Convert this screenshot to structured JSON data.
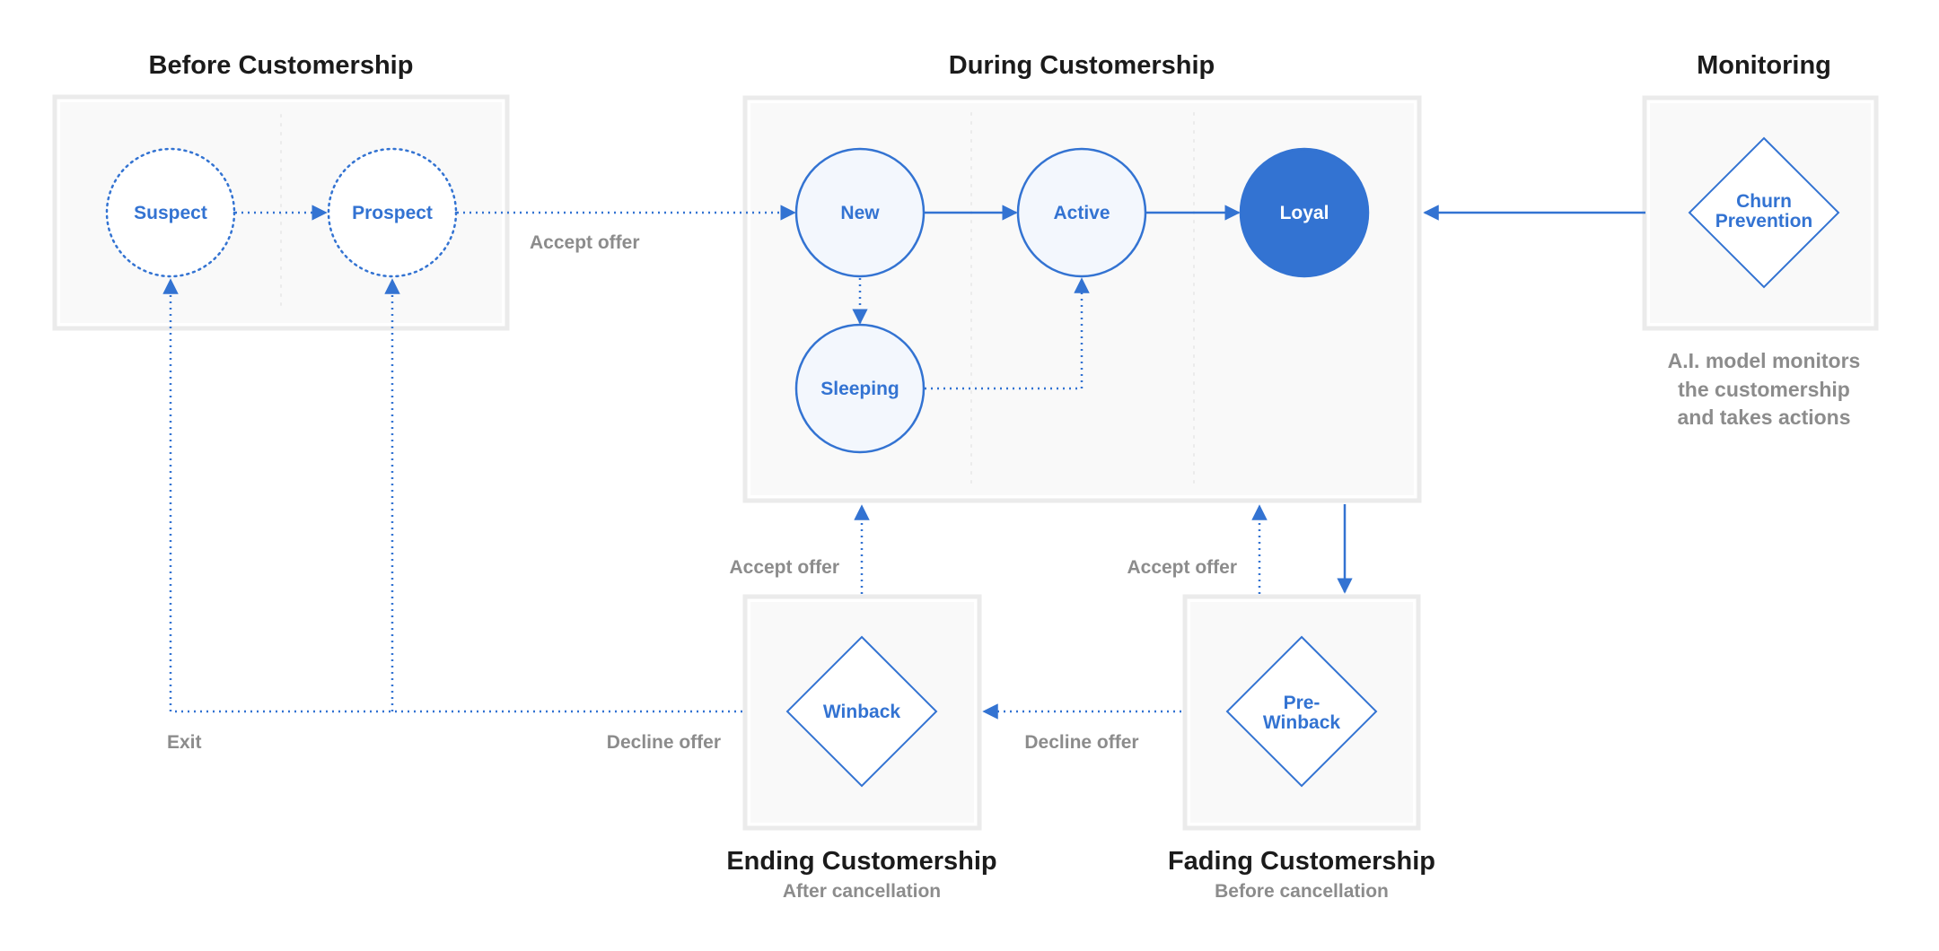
{
  "colors": {
    "accent": "#3373d2",
    "node_fill": "#f3f7fd",
    "panel_fill": "#f9f9f9",
    "panel_border": "#ebebeb",
    "label_gray": "#8c8c8c",
    "title": "#1b1b1b"
  },
  "groups": {
    "before": {
      "title": "Before Customership"
    },
    "during": {
      "title": "During Customership"
    },
    "monitoring": {
      "title": "Monitoring",
      "note": [
        "A.I. model monitors",
        "the customership",
        "and takes actions"
      ]
    },
    "ending": {
      "title": "Ending Customership",
      "subtitle": "After cancellation"
    },
    "fading": {
      "title": "Fading Customership",
      "subtitle": "Before cancellation"
    }
  },
  "nodes": {
    "suspect": {
      "label": "Suspect",
      "shape": "circle",
      "style": "dotted"
    },
    "prospect": {
      "label": "Prospect",
      "shape": "circle",
      "style": "dotted"
    },
    "new": {
      "label": "New",
      "shape": "circle",
      "style": "outline"
    },
    "active": {
      "label": "Active",
      "shape": "circle",
      "style": "outline"
    },
    "loyal": {
      "label": "Loyal",
      "shape": "circle",
      "style": "filled"
    },
    "sleeping": {
      "label": "Sleeping",
      "shape": "circle",
      "style": "outline"
    },
    "churn_prevention": {
      "label_lines": [
        "Churn",
        "Prevention"
      ],
      "shape": "diamond"
    },
    "winback": {
      "label": "Winback",
      "shape": "diamond"
    },
    "pre_winback": {
      "label_lines": [
        "Pre-",
        "Winback"
      ],
      "shape": "diamond"
    }
  },
  "edges": [
    {
      "from": "Suspect",
      "to": "Prospect",
      "style": "dotted"
    },
    {
      "from": "Prospect",
      "to": "New",
      "style": "dotted",
      "label": "Accept offer"
    },
    {
      "from": "New",
      "to": "Active",
      "style": "solid"
    },
    {
      "from": "Active",
      "to": "Loyal",
      "style": "solid"
    },
    {
      "from": "New",
      "to": "Sleeping",
      "style": "dotted"
    },
    {
      "from": "Sleeping",
      "to": "Active",
      "style": "dotted"
    },
    {
      "from": "Churn Prevention",
      "to": "During Customership",
      "style": "solid"
    },
    {
      "from": "During Customership",
      "to": "Pre-Winback",
      "style": "solid"
    },
    {
      "from": "Pre-Winback",
      "to": "During Customership",
      "style": "dotted",
      "label": "Accept offer"
    },
    {
      "from": "Winback",
      "to": "During Customership",
      "style": "dotted",
      "label": "Accept offer"
    },
    {
      "from": "Pre-Winback",
      "to": "Winback",
      "style": "dotted",
      "label": "Decline offer"
    },
    {
      "from": "Winback",
      "to": "Suspect / Prospect",
      "style": "dotted",
      "label": "Decline offer"
    },
    {
      "from": "Winback",
      "to": "Suspect / Prospect",
      "style": "dotted",
      "label": "Exit"
    }
  ],
  "labels": {
    "accept_offer_prospect": "Accept offer",
    "accept_offer_winback": "Accept offer",
    "accept_offer_prewinback": "Accept offer",
    "decline_offer_winback": "Decline offer",
    "decline_offer_prewinback": "Decline offer",
    "exit": "Exit"
  }
}
